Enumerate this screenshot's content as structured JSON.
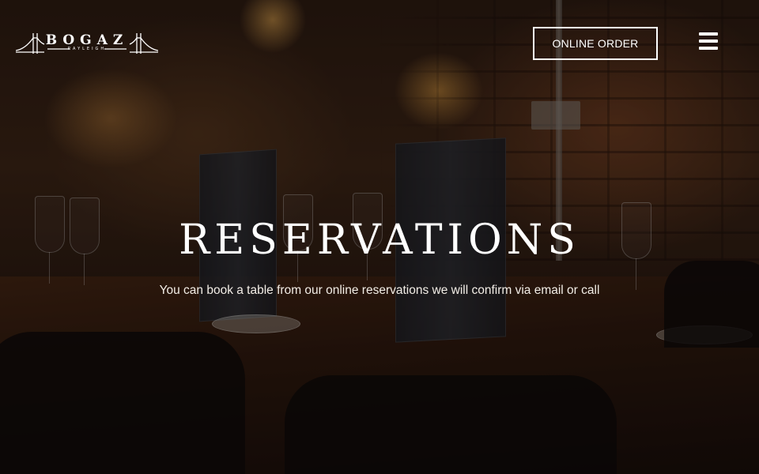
{
  "header": {
    "logo": {
      "name": "BOGAZ",
      "subtitle": "RAYLEIGH",
      "icon": "bridge-icon"
    },
    "online_order_label": "ONLINE ORDER",
    "menu_icon": "hamburger-menu-icon"
  },
  "hero": {
    "title": "RESERVATIONS",
    "subtitle": "You can book a table from our online reservations we will confirm via email or call"
  },
  "colors": {
    "text": "#ffffff",
    "background_dark": "#1a120c"
  }
}
